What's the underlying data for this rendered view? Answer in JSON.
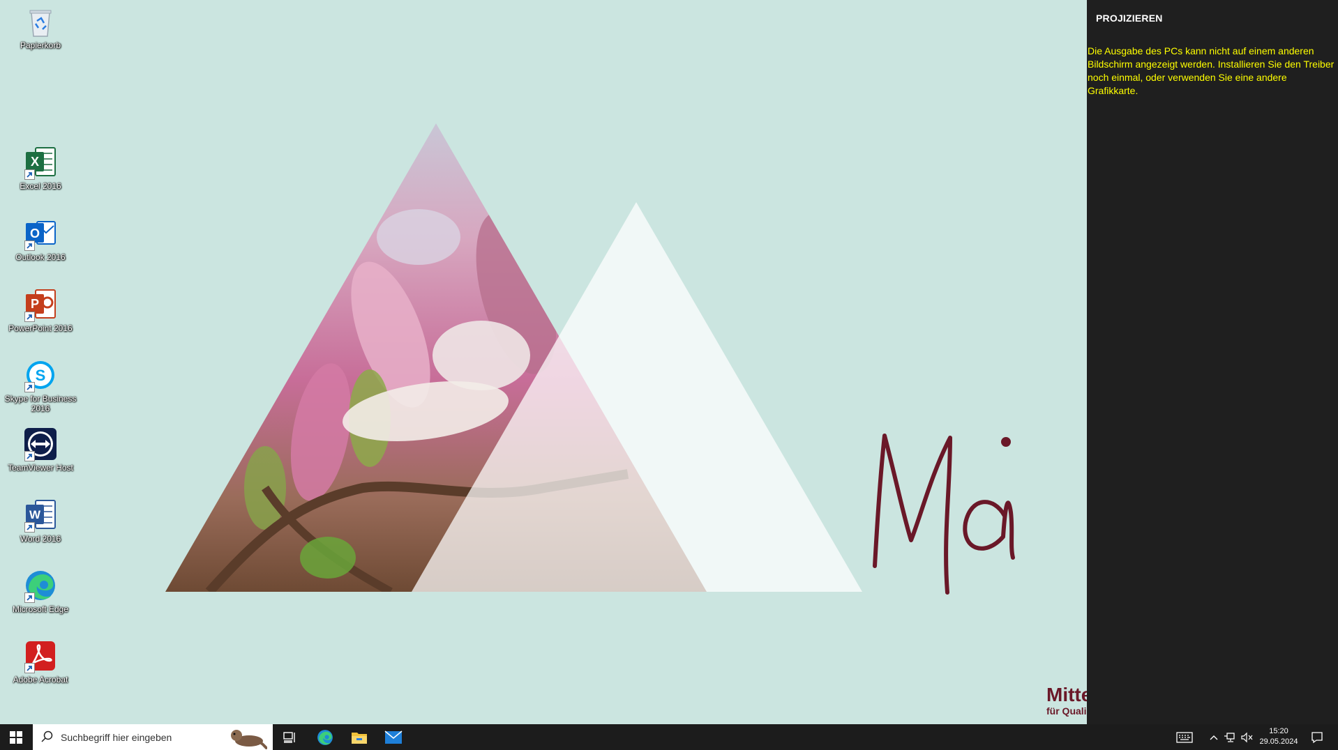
{
  "desktop": {
    "icons": [
      {
        "label": "Papierkorb",
        "icon": "recycle-bin-icon"
      },
      {
        "label": "Excel 2016",
        "icon": "excel-icon"
      },
      {
        "label": "Outlook 2016",
        "icon": "outlook-icon"
      },
      {
        "label": "PowerPoint 2016",
        "icon": "powerpoint-icon"
      },
      {
        "label": "Skype for Business 2016",
        "icon": "skype-icon"
      },
      {
        "label": "TeamViewer Host",
        "icon": "teamviewer-icon"
      },
      {
        "label": "Word 2016",
        "icon": "word-icon"
      },
      {
        "label": "Microsoft Edge",
        "icon": "edge-icon"
      },
      {
        "label": "Adobe Acrobat",
        "icon": "acrobat-icon"
      }
    ],
    "wallpaper": {
      "script_text": "Mai",
      "brand_line1": "Mitte",
      "brand_line2": "für Quali",
      "accent_color": "#6a1828",
      "background_color": "#cbe5e0"
    }
  },
  "project_panel": {
    "title": "PROJIZIEREN",
    "message": "Die Ausgabe des PCs kann nicht auf einem anderen Bildschirm angezeigt werden. Installieren Sie den Treiber noch einmal, oder verwenden Sie eine andere Grafikkarte.",
    "message_color": "#ffff00",
    "background_color": "#1f1f1f"
  },
  "taskbar": {
    "search_placeholder": "Suchbegriff hier eingeben",
    "pinned": [
      "task-view-icon",
      "edge-icon",
      "file-explorer-icon",
      "mail-icon"
    ],
    "tray": {
      "time": "15:20",
      "date": "29.05.2024"
    }
  }
}
